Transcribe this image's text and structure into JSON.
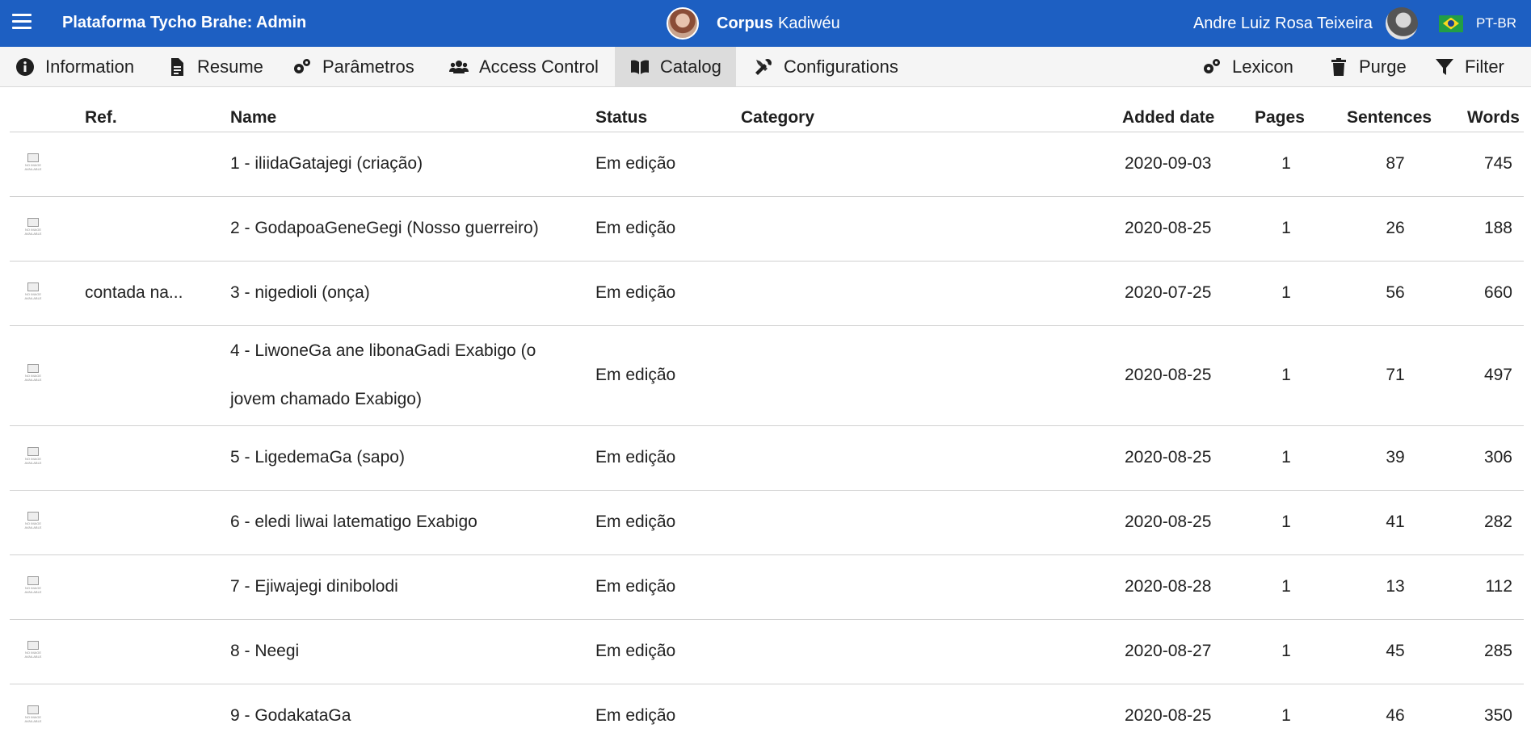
{
  "header": {
    "app_title": "Plataforma Tycho Brahe: Admin",
    "corpus_label": "Corpus",
    "corpus_name": "Kadiwéu",
    "user_name": "Andre Luiz Rosa Teixeira",
    "language": "PT-BR"
  },
  "menu": {
    "information": "Information",
    "resume": "Resume",
    "parametros": "Parâmetros",
    "access_control": "Access Control",
    "catalog": "Catalog",
    "configurations": "Configurations",
    "lexicon": "Lexicon",
    "purge": "Purge",
    "filter": "Filter",
    "active": "Catalog"
  },
  "table": {
    "headers": {
      "ref": "Ref.",
      "name": "Name",
      "status": "Status",
      "category": "Category",
      "added_date": "Added date",
      "pages": "Pages",
      "sentences": "Sentences",
      "words": "Words"
    },
    "thumbnail_caption": "NO IMAGE AVAILABLE",
    "rows": [
      {
        "ref": "",
        "name": "1 - iliidaGatajegi (criação)",
        "status": "Em edição",
        "category": "",
        "added_date": "2020-09-03",
        "pages": "1",
        "sentences": "87",
        "words": "745"
      },
      {
        "ref": "",
        "name": "2 - GodapoaGeneGegi (Nosso guerreiro)",
        "status": "Em edição",
        "category": "",
        "added_date": "2020-08-25",
        "pages": "1",
        "sentences": "26",
        "words": "188"
      },
      {
        "ref": "contada na...",
        "name": "3 - nigedioli (onça)",
        "status": "Em edição",
        "category": "",
        "added_date": "2020-07-25",
        "pages": "1",
        "sentences": "56",
        "words": "660"
      },
      {
        "ref": "",
        "name_line1": "4 - LiwoneGa ane libonaGadi Exabigo (o",
        "name_line2": "jovem chamado Exabigo)",
        "status": "Em edição",
        "category": "",
        "added_date": "2020-08-25",
        "pages": "1",
        "sentences": "71",
        "words": "497"
      },
      {
        "ref": "",
        "name": "5 - LigedemaGa (sapo)",
        "status": "Em edição",
        "category": "",
        "added_date": "2020-08-25",
        "pages": "1",
        "sentences": "39",
        "words": "306"
      },
      {
        "ref": "",
        "name": "6 - eledi liwai latematigo Exabigo",
        "status": "Em edição",
        "category": "",
        "added_date": "2020-08-25",
        "pages": "1",
        "sentences": "41",
        "words": "282"
      },
      {
        "ref": "",
        "name": "7 - Ejiwajegi dinibolodi",
        "status": "Em edição",
        "category": "",
        "added_date": "2020-08-28",
        "pages": "1",
        "sentences": "13",
        "words": "112"
      },
      {
        "ref": "",
        "name": "8 - Neegi",
        "status": "Em edição",
        "category": "",
        "added_date": "2020-08-27",
        "pages": "1",
        "sentences": "45",
        "words": "285"
      },
      {
        "ref": "",
        "name": "9 - GodakataGa",
        "status": "Em edição",
        "category": "",
        "added_date": "2020-08-25",
        "pages": "1",
        "sentences": "46",
        "words": "350"
      }
    ]
  },
  "colors": {
    "topbar": "#1d5fc2",
    "menubar": "#f5f5f5",
    "menu_active": "#dcdcdc"
  }
}
